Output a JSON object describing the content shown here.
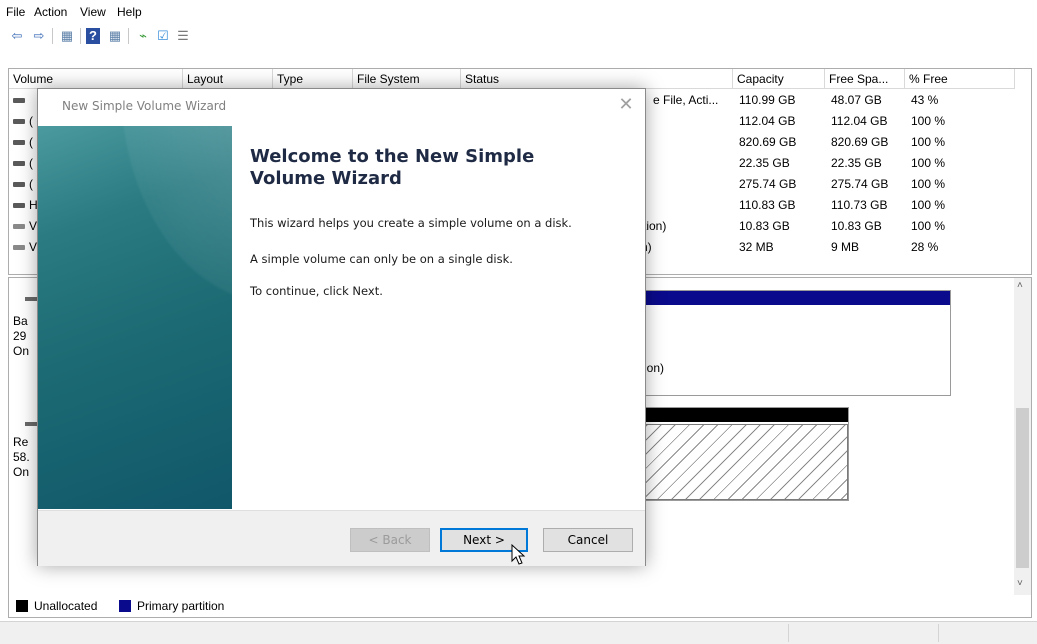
{
  "menu": [
    "File",
    "Action",
    "View",
    "Help"
  ],
  "toolbar_icons": [
    "back-arrow-icon",
    "forward-arrow-icon",
    "console-tree-icon",
    "help-icon",
    "action-pane-icon",
    "connect-icon",
    "check-icon",
    "properties-icon"
  ],
  "table": {
    "columns": [
      "Volume",
      "Layout",
      "Type",
      "File System",
      "Status",
      "Capacity",
      "Free Spa...",
      "% Free"
    ],
    "rows": [
      {
        "volume": "",
        "status": "e File, Acti...",
        "capacity": "110.99 GB",
        "free": "48.07 GB",
        "pct": "43 %"
      },
      {
        "volume": "(",
        "status": "",
        "capacity": "112.04 GB",
        "free": "112.04 GB",
        "pct": "100 %"
      },
      {
        "volume": "(",
        "status": "",
        "capacity": "820.69 GB",
        "free": "820.69 GB",
        "pct": "100 %"
      },
      {
        "volume": "(",
        "status": "",
        "capacity": "22.35 GB",
        "free": "22.35 GB",
        "pct": "100 %"
      },
      {
        "volume": "(",
        "status": "",
        "capacity": "275.74 GB",
        "free": "275.74 GB",
        "pct": "100 %"
      },
      {
        "volume": "H",
        "status": "",
        "capacity": "110.83 GB",
        "free": "110.73 GB",
        "pct": "100 %"
      },
      {
        "volume": "V",
        "status": "rtition)",
        "capacity": "10.83 GB",
        "free": "10.83 GB",
        "pct": "100 %"
      },
      {
        "volume": "V",
        "status": "n)",
        "capacity": "32 MB",
        "free": "9 MB",
        "pct": "28 %"
      }
    ]
  },
  "disks": {
    "disk0": {
      "l1": "Ba",
      "l2": "29",
      "l3": "On",
      "partition_text": "ition)"
    },
    "disk1": {
      "l1": "Re",
      "l2": "58.",
      "l3": "On"
    }
  },
  "legend": {
    "unallocated": "Unallocated",
    "primary": "Primary partition",
    "unallocated_color": "#000000",
    "primary_color": "#0a0a8c"
  },
  "wizard": {
    "title": "New Simple Volume Wizard",
    "heading_line1": "Welcome to the New Simple",
    "heading_line2": "Volume Wizard",
    "text1": "This wizard helps you create a simple volume on a disk.",
    "text2": "A simple volume can only be on a single disk.",
    "text3": "To continue, click Next.",
    "back": "< Back",
    "next": "Next >",
    "cancel": "Cancel"
  }
}
